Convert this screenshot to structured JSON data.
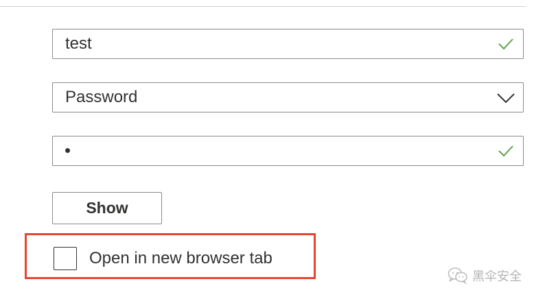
{
  "form": {
    "username": {
      "value": "test",
      "status_icon": "checkmark-icon"
    },
    "auth_method": {
      "selected": "Password",
      "icon": "chevron-down-icon"
    },
    "password": {
      "masked_value": "•",
      "status_icon": "checkmark-icon"
    },
    "show_button_label": "Show",
    "open_new_tab": {
      "label": "Open in new browser tab",
      "checked": false
    }
  },
  "annotation": {
    "highlight_color": "#e8432f"
  },
  "watermark": {
    "text": "黑伞安全",
    "icon": "wechat-icon"
  },
  "colors": {
    "check_green": "#5ba34a",
    "border": "#8a8886",
    "text": "#323130"
  }
}
